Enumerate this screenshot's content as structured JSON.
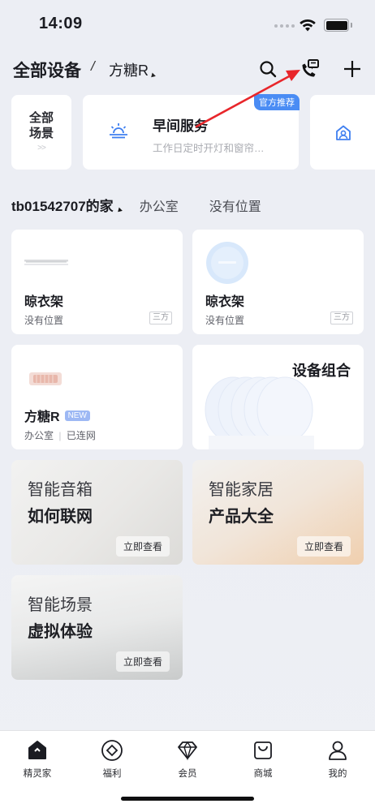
{
  "status_bar": {
    "time": "14:09"
  },
  "header": {
    "title": "全部设备",
    "separator": "/",
    "selected_device": "方糖R"
  },
  "scenes": {
    "all_label_line1": "全部",
    "all_label_line2": "场景",
    "all_arrow": ">>",
    "featured": {
      "name": "早间服务",
      "description": "工作日定时开灯和窗帘…",
      "badge": "官方推荐"
    }
  },
  "rooms": {
    "current": "tb01542707的家",
    "tabs": [
      "办公室",
      "没有位置"
    ]
  },
  "devices": [
    {
      "name": "晾衣架",
      "location": "没有位置",
      "tag": "三方"
    },
    {
      "name": "晾衣架",
      "location": "没有位置",
      "tag": "三方"
    },
    {
      "name": "方糖R",
      "badge": "NEW",
      "location": "办公室",
      "divider": "|",
      "status": "已连网"
    }
  ],
  "device_combo": {
    "title": "设备组合"
  },
  "promos": [
    {
      "line1": "智能音箱",
      "line2": "如何联网",
      "button": "立即查看"
    },
    {
      "line1": "智能家居",
      "line2": "产品大全",
      "button": "立即查看"
    },
    {
      "line1": "智能场景",
      "line2": "虚拟体验",
      "button": "立即查看"
    }
  ],
  "tabbar": {
    "items": [
      {
        "label": "精灵家",
        "icon": "home-icon",
        "active": true
      },
      {
        "label": "福利",
        "icon": "gift-diamond-icon"
      },
      {
        "label": "会员",
        "icon": "diamond-icon"
      },
      {
        "label": "商城",
        "icon": "shopping-bag-icon"
      },
      {
        "label": "我的",
        "icon": "profile-icon"
      }
    ]
  },
  "colors": {
    "accent_blue": "#4a8cf4",
    "annotation_arrow": "#e8262b",
    "background": "#eceef4"
  }
}
